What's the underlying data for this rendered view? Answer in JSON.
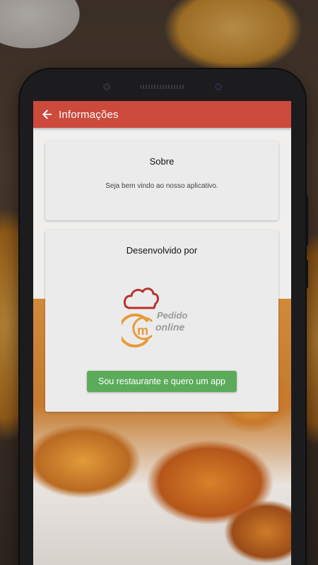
{
  "toolbar": {
    "title": "Informações",
    "back_icon": "arrow-left-icon",
    "color": "#cc4a3c"
  },
  "about_card": {
    "title": "Sobre",
    "text": "Seja bem vindo ao nosso aplicativo."
  },
  "developer_card": {
    "title": "Desenvolvido por",
    "logo": {
      "icon": "chef-hat-logo-icon",
      "line1": "Pedido",
      "line2": "online",
      "accent_color": "#e89a3a",
      "hat_color": "#b8322c"
    },
    "button_label": "Sou restaurante e quero um app",
    "button_color": "#5cab5a"
  }
}
